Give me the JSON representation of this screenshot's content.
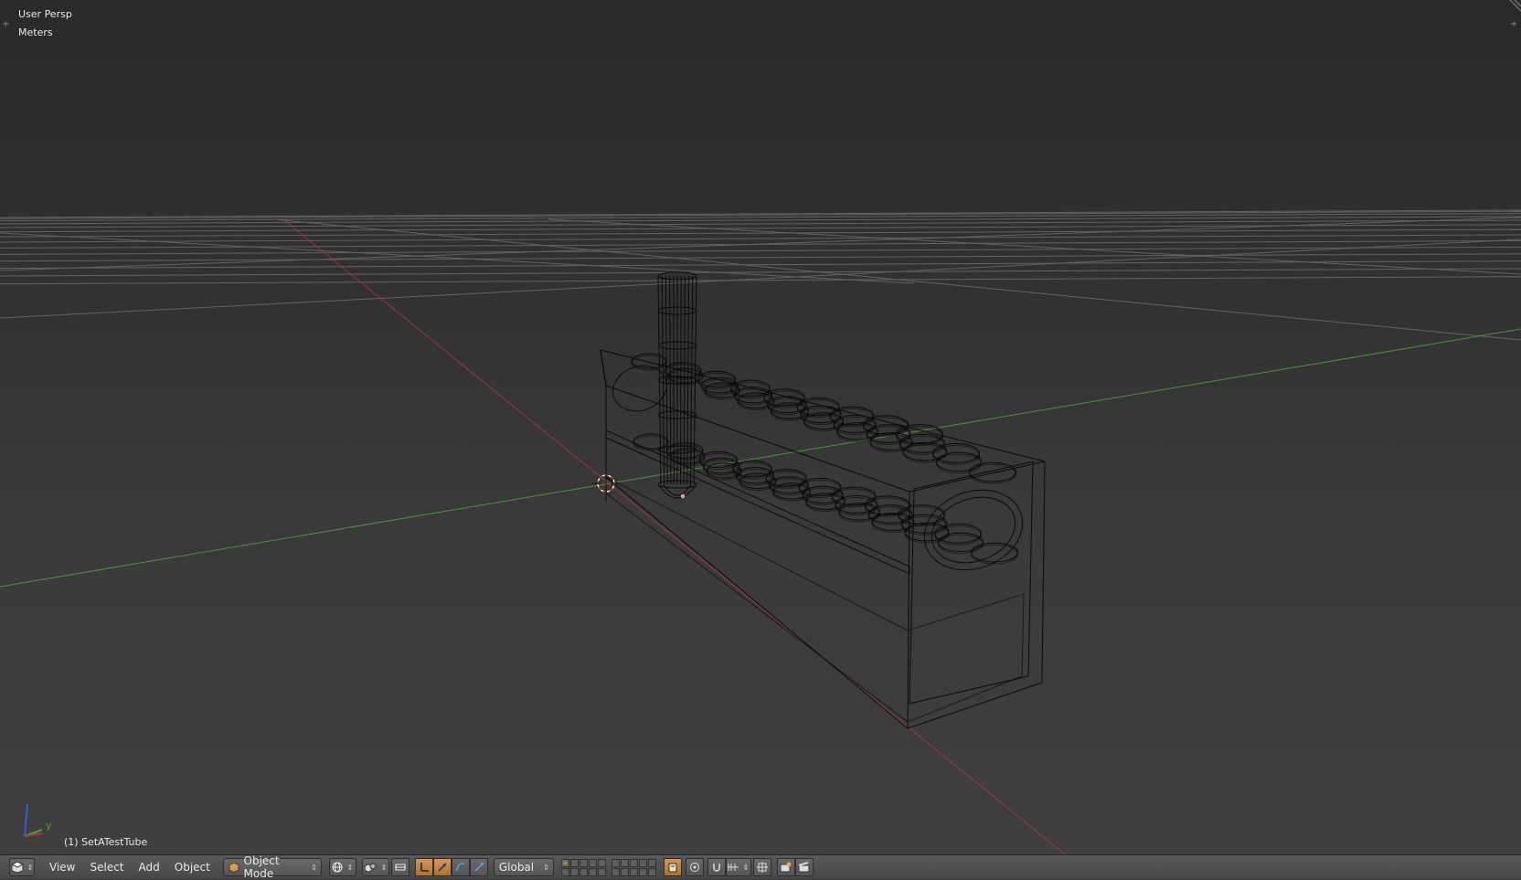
{
  "viewport": {
    "view_name": "User Persp",
    "units": "Meters",
    "active_object": "(1) SetATestTube",
    "axis_labels": {
      "y": "y"
    },
    "colors": {
      "x_axis": "#b03a3a",
      "y_axis": "#4ea23a",
      "z_axis": "#3a5ad0",
      "wire": "#0a0a0a",
      "grid": "#8a8a8a"
    }
  },
  "header": {
    "editor_type_icon": "3d-view-icon",
    "menus": [
      "View",
      "Select",
      "Add",
      "Object"
    ],
    "mode": {
      "icon": "cube-icon",
      "label": "Object Mode"
    },
    "shading_icon": "sphere-shading-icon",
    "pivot_icon": "pivot-point-icon",
    "manipulator_icons": [
      "transform-manipulator-icon",
      "translate-icon",
      "rotate-icon",
      "scale-icon"
    ],
    "orientation": "Global",
    "snap_icons": [
      "lock-camera-icon",
      "proportional-edit-icon",
      "snap-magnet-icon",
      "snap-target-icon",
      "snap-element-icon"
    ],
    "render_icons": [
      "opengl-render-icon",
      "opengl-anim-icon"
    ]
  }
}
